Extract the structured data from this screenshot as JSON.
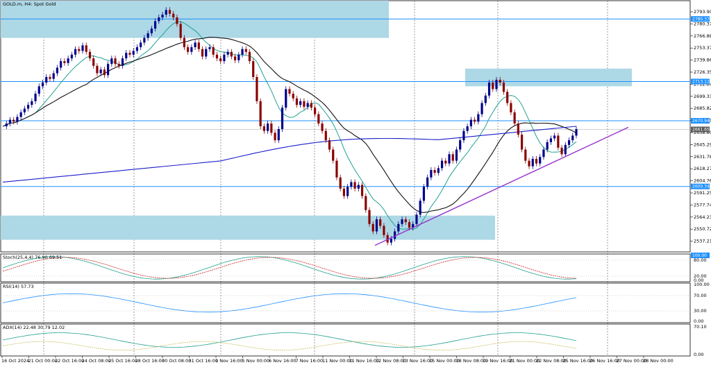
{
  "main_panel": {
    "title": "GOLD.m, H4:  Spot Gold",
    "price_ticks": [
      "2793.90",
      "2780.37",
      "2766.88",
      "2753.37",
      "2739.86",
      "2726.35",
      "2712.84",
      "2699.33",
      "2685.82",
      "2672.31",
      "2658.80",
      "2645.29",
      "2631.78",
      "2618.27",
      "2604.76",
      "2591.25",
      "2577.74",
      "2564.23",
      "2550.72",
      "2537.21"
    ],
    "price_tags": [
      {
        "text": "2780.37",
        "value": 2780.37,
        "color": "#1e90ff"
      },
      {
        "text": "2713.12",
        "value": 2713.12,
        "color": "#1e90ff"
      },
      {
        "text": "2670.94",
        "value": 2670.94,
        "color": "#1e90ff"
      },
      {
        "text": "2661.65",
        "value": 2661.65,
        "color": "#5a5a5a"
      },
      {
        "text": "2600.34",
        "value": 2600.34,
        "color": "#1e90ff"
      }
    ]
  },
  "stoch_panel": {
    "label": "Stoch(25,4,4) 76.90 69.51",
    "ticks": [
      "100.00",
      "80.00",
      "20.00",
      "0.00"
    ],
    "tag": "100.00"
  },
  "rsi_panel": {
    "label": "RSI(14) 57.73",
    "ticks": [
      "100.00",
      "70.00",
      "30.00",
      "0.00"
    ]
  },
  "adx_panel": {
    "label": "ADX(14) 22.48 30.79 12.02",
    "ticks": [
      "70.10",
      "0.00"
    ]
  },
  "time_axis": {
    "labels": [
      "16 Oct 2024",
      "21 Oct 00:00",
      "22 Oct 16:00",
      "24 Oct 08:00",
      "25 Oct 16:00",
      "28 Oct 16:00",
      "30 Oct 08:00",
      "31 Oct 16:00",
      "1 Nov 16:00",
      "5 Nov 00:00",
      "6 Nov 16:00",
      "7 Nov 16:00",
      "11 Nov 00:00",
      "11 Nov 16:00",
      "12 Nov 08:00",
      "13 Nov 16:00",
      "15 Nov 00:00",
      "18 Nov 08:00",
      "19 Nov 16:00",
      "21 Nov 00:00",
      "22 Nov 08:00",
      "25 Nov 16:00",
      "26 Nov 16:00",
      "27 Nov 00:00",
      "28 Nov 00:00"
    ]
  },
  "chart_data": {
    "type": "candlestick",
    "symbol": "GOLD.m",
    "timeframe": "H4",
    "ylim": [
      2530,
      2800
    ],
    "support_resistance_lines": [
      2780.37,
      2713.12,
      2670.94,
      2600.34
    ],
    "zones": [
      {
        "from": 2760,
        "to": 2803
      },
      {
        "from": 2708,
        "to": 2727
      },
      {
        "from": 2543,
        "to": 2569
      }
    ],
    "trendline": [
      [
        2537,
        2664
      ]
    ],
    "closes": [
      2665,
      2668,
      2672,
      2670,
      2675,
      2680,
      2684,
      2688,
      2692,
      2700,
      2708,
      2712,
      2718,
      2716,
      2722,
      2728,
      2735,
      2733,
      2738,
      2742,
      2748,
      2746,
      2752,
      2745,
      2738,
      2730,
      2722,
      2726,
      2720,
      2732,
      2738,
      2732,
      2730,
      2738,
      2744,
      2742,
      2746,
      2750,
      2755,
      2760,
      2765,
      2770,
      2778,
      2782,
      2785,
      2790,
      2786,
      2782,
      2775,
      2760,
      2750,
      2745,
      2750,
      2755,
      2748,
      2740,
      2748,
      2750,
      2742,
      2738,
      2735,
      2742,
      2745,
      2740,
      2736,
      2742,
      2748,
      2745,
      2735,
      2718,
      2692,
      2665,
      2660,
      2668,
      2658,
      2650,
      2662,
      2685,
      2705,
      2700,
      2695,
      2688,
      2692,
      2686,
      2690,
      2685,
      2678,
      2668,
      2660,
      2650,
      2640,
      2628,
      2610,
      2598,
      2590,
      2600,
      2605,
      2598,
      2602,
      2590,
      2575,
      2560,
      2552,
      2565,
      2558,
      2548,
      2540,
      2544,
      2552,
      2560,
      2565,
      2562,
      2556,
      2560,
      2570,
      2585,
      2600,
      2610,
      2618,
      2615,
      2620,
      2628,
      2625,
      2635,
      2628,
      2640,
      2650,
      2660,
      2665,
      2672,
      2670,
      2678,
      2690,
      2698,
      2712,
      2705,
      2715,
      2712,
      2702,
      2690,
      2680,
      2668,
      2656,
      2640,
      2628,
      2622,
      2630,
      2625,
      2632,
      2640,
      2648,
      2652,
      2655,
      2642,
      2635,
      2645,
      2650,
      2655,
      2662
    ]
  },
  "colors": {
    "zone": "#add8e6",
    "hline": "#1e90ff",
    "bull": "#00008b",
    "bear": "#8b0000",
    "ma_fast": "#20a090",
    "ma_mid": "#111111",
    "ma_slow": "#1c1ccc",
    "trend": "#9933cc"
  }
}
